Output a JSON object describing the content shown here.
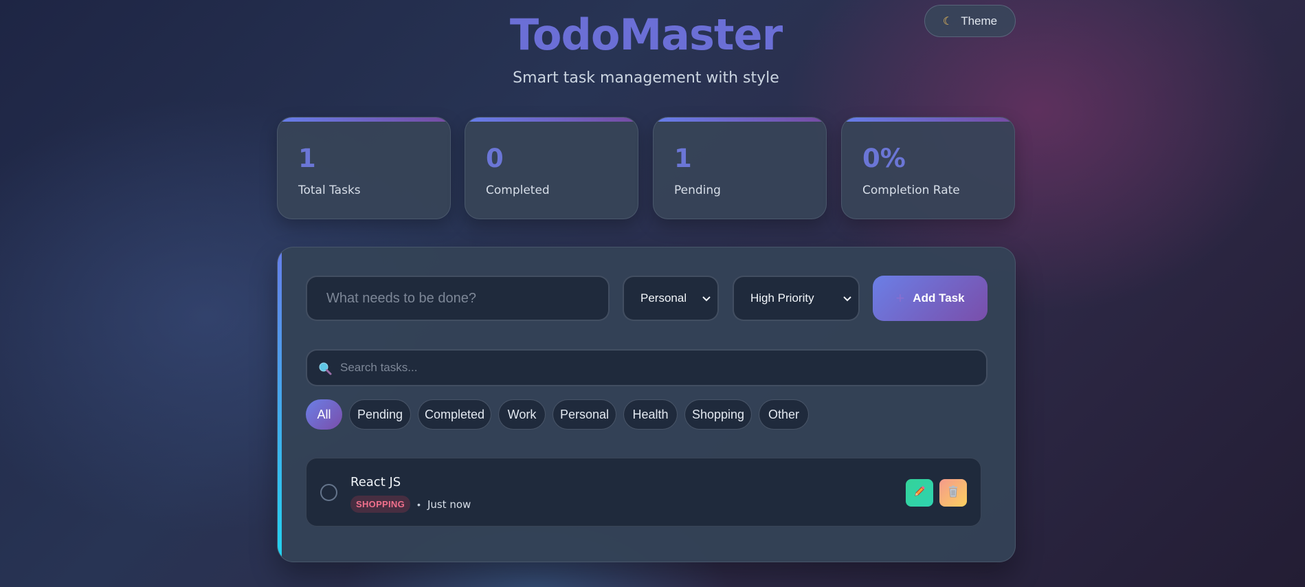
{
  "header": {
    "title": "TodoMaster",
    "subtitle": "Smart task management with style",
    "theme_label": "Theme",
    "theme_icon": "moon-icon"
  },
  "stats": [
    {
      "value": "1",
      "label": "Total Tasks"
    },
    {
      "value": "0",
      "label": "Completed"
    },
    {
      "value": "1",
      "label": "Pending"
    },
    {
      "value": "0%",
      "label": "Completion Rate"
    }
  ],
  "task_form": {
    "input_placeholder": "What needs to be done?",
    "input_value": "",
    "category_selected": "Personal",
    "priority_selected": "High Priority",
    "add_label": "Add Task",
    "add_icon": "plus-icon"
  },
  "search": {
    "placeholder": "Search tasks...",
    "value": "",
    "icon": "search-icon"
  },
  "filters": {
    "active": "All",
    "items": [
      "All",
      "Pending",
      "Completed",
      "Work",
      "Personal",
      "Health",
      "Shopping",
      "Other"
    ]
  },
  "tasks": [
    {
      "title": "React JS",
      "category": "SHOPPING",
      "separator": "•",
      "time": "Just now",
      "completed": false,
      "edit_icon": "pencil-icon",
      "delete_icon": "trash-icon"
    }
  ],
  "colors": {
    "accent": "#667eea",
    "accent_end": "#764ba2",
    "title": "#6b6fd6",
    "edit": "#34d399",
    "delete_start": "#f49a8c",
    "delete_end": "#fcd05f",
    "badge_text": "#f0708c"
  }
}
